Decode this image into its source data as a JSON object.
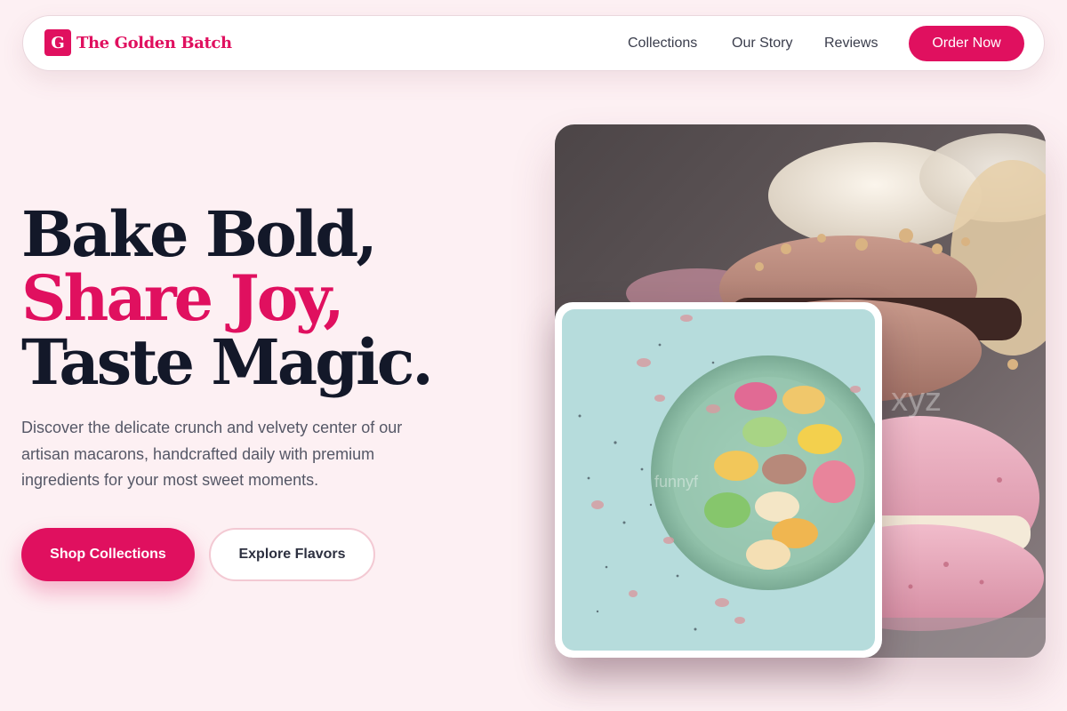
{
  "brand": {
    "logo_letter": "G",
    "name": "The Golden Batch"
  },
  "nav": {
    "links": [
      "Collections",
      "Our Story",
      "Reviews"
    ],
    "cta_label": "Order Now"
  },
  "hero": {
    "title_lines": [
      "Bake Bold,",
      "Share Joy,",
      "Taste Magic."
    ],
    "description": "Discover the delicate crunch and velvety center of our artisan macarons, handcrafted daily with premium ingredients for your most sweet moments.",
    "primary_button": "Shop Collections",
    "secondary_button": "Explore Flavors"
  },
  "images": {
    "main_watermark": "xyz",
    "inset_watermark": "funnyf"
  },
  "colors": {
    "accent": "#e0105f",
    "background": "#fdf0f3",
    "heading": "#131829",
    "body_text": "#555766"
  },
  "icons": {
    "logo": "letter-g-logo-icon"
  }
}
